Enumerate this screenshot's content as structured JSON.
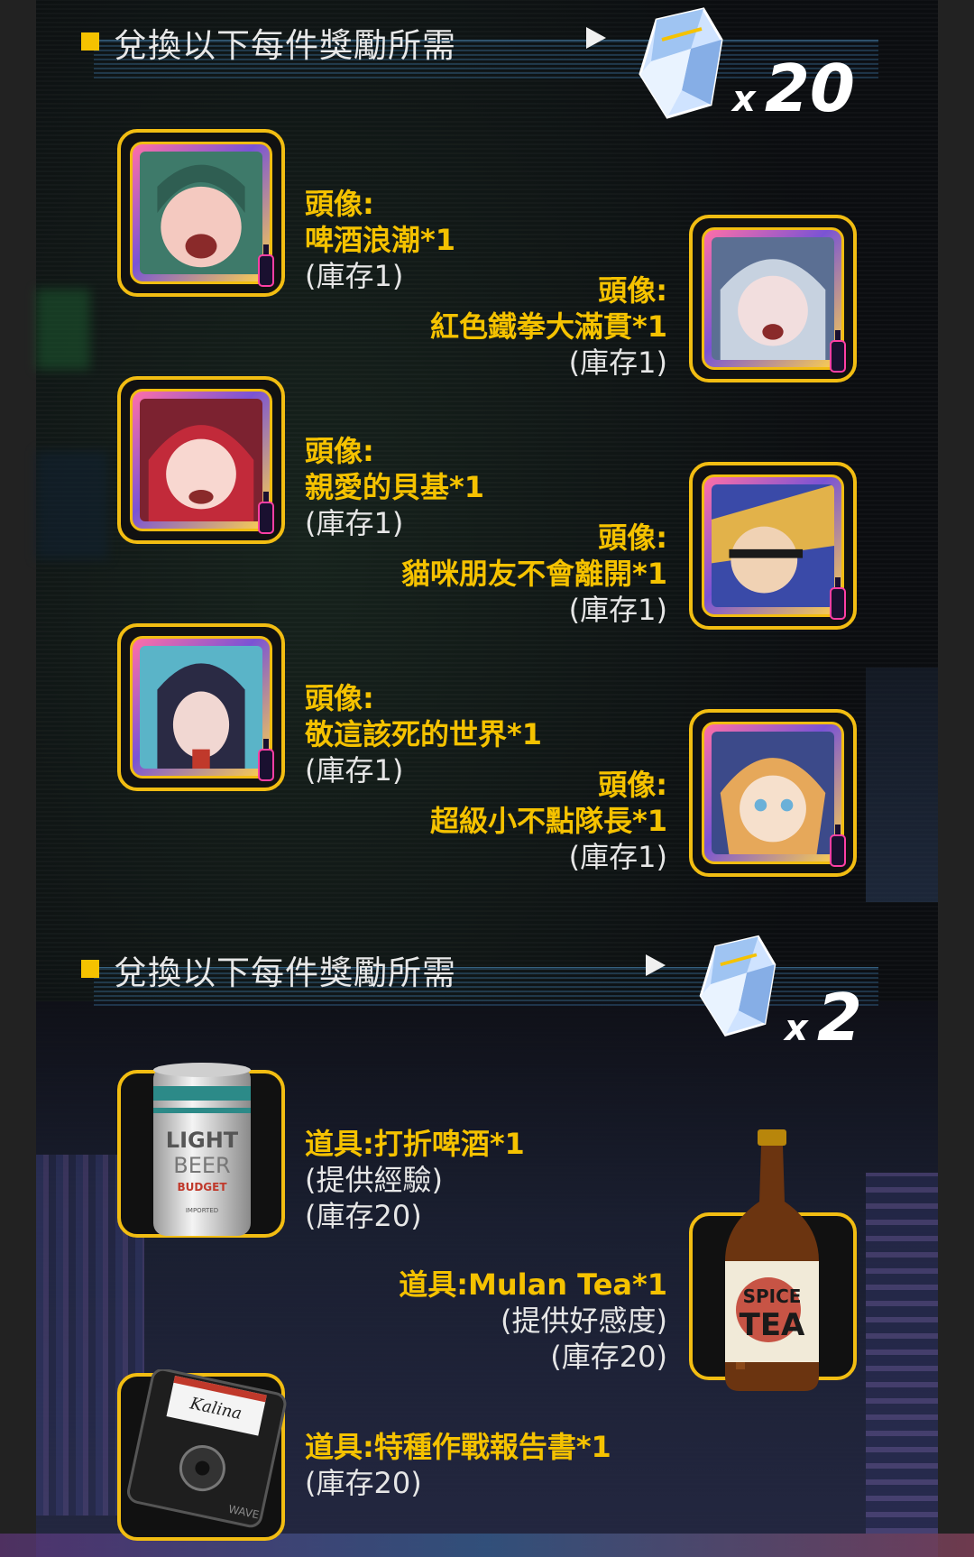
{
  "section1": {
    "title": "兌換以下每件獎勵所需",
    "cost": {
      "multiplier_prefix": "x",
      "amount": "20",
      "currency_icon": "crystal-icon"
    },
    "rewards": [
      {
        "type_label": "頭像:",
        "name": "啤酒浪潮*1",
        "stock": "(庫存1)",
        "art_colors": [
          "#3e7a6a",
          "#f4c9c0",
          "#b0d8c8"
        ]
      },
      {
        "type_label": "頭像:",
        "name": "紅色鐵拳大滿貫*1",
        "stock": "(庫存1)",
        "art_colors": [
          "#c7d2e0",
          "#f2dede",
          "#5b6f93"
        ]
      },
      {
        "type_label": "頭像:",
        "name": "親愛的貝基*1",
        "stock": "(庫存1)",
        "art_colors": [
          "#c22a3a",
          "#f8d7d0",
          "#7c2230"
        ]
      },
      {
        "type_label": "頭像:",
        "name": "貓咪朋友不會離開*1",
        "stock": "(庫存1)",
        "art_colors": [
          "#e2b24a",
          "#3a4aa8",
          "#f0d2b4"
        ]
      },
      {
        "type_label": "頭像:",
        "name": "敬這該死的世界*1",
        "stock": "(庫存1)",
        "art_colors": [
          "#2a2a44",
          "#f1d7d2",
          "#5ab4c8"
        ]
      },
      {
        "type_label": "頭像:",
        "name": "超級小不點隊長*1",
        "stock": "(庫存1)",
        "art_colors": [
          "#e6a85a",
          "#f6e0cc",
          "#3c4a8a"
        ]
      }
    ]
  },
  "section2": {
    "title": "兌換以下每件獎勵所需",
    "cost": {
      "multiplier_prefix": "x",
      "amount": "2",
      "currency_icon": "crystal-icon"
    },
    "items": [
      {
        "type_label": "道具:",
        "name": "打折啤酒*1",
        "desc": "(提供經驗)",
        "stock": "(庫存20)",
        "icon": "beer-can-icon",
        "can_text": {
          "line1": "LIGHT",
          "line2": "BEER",
          "line3": "BUDGET",
          "line4": "IMPORTED"
        }
      },
      {
        "type_label": "道具:",
        "name": "Mulan Tea*1",
        "desc": "(提供好感度)",
        "stock": "(庫存20)",
        "icon": "tea-bottle-icon",
        "bottle_text": {
          "line1": "SPICE",
          "line2": "TEA"
        }
      },
      {
        "type_label": "道具:",
        "name": "特種作戰報告書*1",
        "stock": "(庫存20)",
        "icon": "floppy-disk-icon",
        "disk_text": {
          "label": "Kalina",
          "brand": "WAVE"
        }
      }
    ]
  },
  "colors": {
    "accent": "#f5c200",
    "frame": "#f2bd12",
    "text": "#e6e6e6",
    "background": "#0b0c0f"
  }
}
